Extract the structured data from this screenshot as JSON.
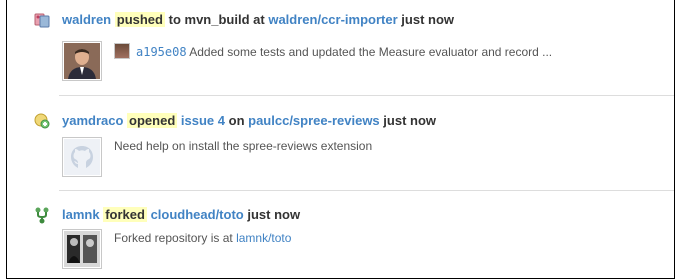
{
  "events": [
    {
      "actor": "waldren",
      "verb": "pushed",
      "connector": "to",
      "branch": "mvn_build",
      "at": "at",
      "repo": "waldren/ccr-importer",
      "time": "just now",
      "commit_sha": "a195e08",
      "commit_message": "Added some tests and updated the Measure evaluator and record ..."
    },
    {
      "actor": "yamdraco",
      "verb": "opened",
      "issue": "issue 4",
      "on": "on",
      "repo": "paulcc/spree-reviews",
      "time": "just now",
      "description": "Need help on install the spree-reviews extension"
    },
    {
      "actor": "lamnk",
      "verb": "forked",
      "repo": "cloudhead/toto",
      "time": "just now",
      "description_prefix": "Forked repository is at",
      "fork_link": "lamnk/toto"
    }
  ],
  "colors": {
    "link": "#4183c4",
    "verb_highlight": "#ffffbb",
    "text": "#333333"
  },
  "icons": [
    "push-icon",
    "issue-opened-icon",
    "fork-icon",
    "octocat-avatar-icon"
  ]
}
